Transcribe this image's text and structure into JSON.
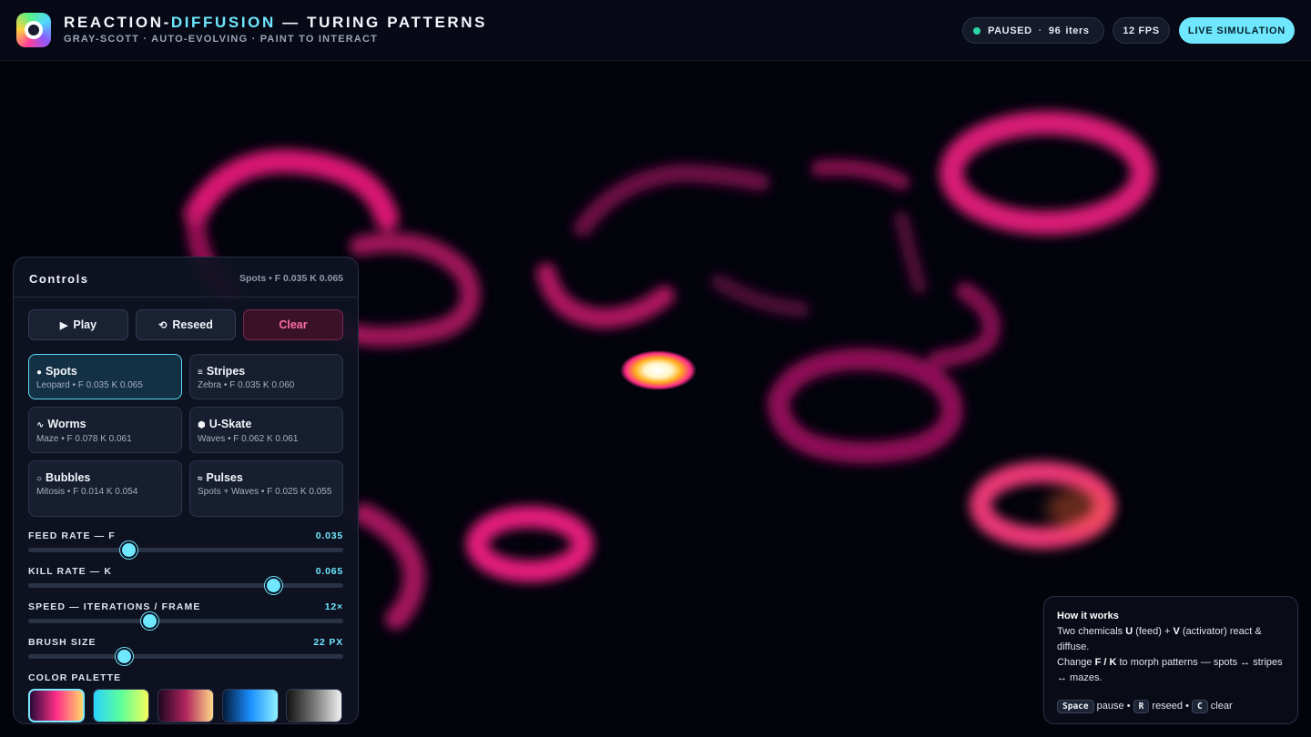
{
  "header": {
    "title_part1": "REACTION-",
    "title_accent": "DIFFUSION",
    "title_part2": " — TURING PATTERNS",
    "subtitle": "GRAY-SCOTT · AUTO-EVOLVING · PAINT TO INTERACT",
    "status": "PAUSED",
    "separator": "·",
    "iterations": "96",
    "iterations_unit": "iters",
    "fps": "12 FPS",
    "live_button": "LIVE SIMULATION",
    "status_dot_color": "#2bd4a4",
    "accent_color": "#6fe6ff"
  },
  "controls": {
    "title": "Controls",
    "current_preset": "Spots • F 0.035 K 0.065",
    "buttons": {
      "play": "Play",
      "play_icon": "▶",
      "reseed": "Reseed",
      "reseed_icon": "⟲",
      "clear": "Clear"
    },
    "presets": [
      {
        "icon": "●",
        "name": "Spots",
        "desc": "Leopard • F 0.035 K 0.065",
        "active": true
      },
      {
        "icon": "≡",
        "name": "Stripes",
        "desc": "Zebra • F 0.035 K 0.060",
        "active": false
      },
      {
        "icon": "∿",
        "name": "Worms",
        "desc": "Maze • F 0.078 K 0.061",
        "active": false
      },
      {
        "icon": "⬢",
        "name": "U-Skate",
        "desc": "Waves • F 0.062 K 0.061",
        "active": false
      },
      {
        "icon": "○",
        "name": "Bubbles",
        "desc": "Mitosis • F 0.014 K 0.054",
        "active": false
      },
      {
        "icon": "≈",
        "name": "Pulses",
        "desc": "Spots + Waves • F 0.025 K 0.055",
        "active": false
      }
    ],
    "sliders": {
      "feed": {
        "label": "FEED RATE — F",
        "value": "0.035",
        "position": 0.32
      },
      "kill": {
        "label": "KILL RATE — K",
        "value": "0.065",
        "position": 0.78
      },
      "speed": {
        "label": "SPEED — ITERATIONS / FRAME",
        "value": "12×",
        "position": 0.385
      },
      "brush": {
        "label": "BRUSH SIZE",
        "value": "22 PX",
        "position": 0.305
      }
    },
    "palette_label": "COLOR PALETTE",
    "palettes": [
      {
        "name": "magma",
        "colors": [
          "#2a0a3a",
          "#ff2e88",
          "#ffd76a"
        ],
        "selected": true
      },
      {
        "name": "aurora",
        "colors": [
          "#2ad3ff",
          "#5cff9a",
          "#f7ff5a"
        ],
        "selected": false
      },
      {
        "name": "ember",
        "colors": [
          "#1d0620",
          "#b0245c",
          "#ffd98a"
        ],
        "selected": false
      },
      {
        "name": "ocean",
        "colors": [
          "#021a3a",
          "#1a8fff",
          "#8ff0ff"
        ],
        "selected": false
      },
      {
        "name": "mono",
        "colors": [
          "#111111",
          "#777777",
          "#f2f2f2"
        ],
        "selected": false
      }
    ]
  },
  "info": {
    "heading": "How it works",
    "line1_a": "Two chemicals ",
    "line1_u": "U",
    "line1_b": " (feed) + ",
    "line1_v": "V",
    "line1_c": " (activator) react & diffuse.",
    "line2_a": "Change ",
    "line2_fk": "F / K",
    "line2_b": " to morph patterns — spots ↔ stripes ↔ mazes.",
    "key_space": "Space",
    "key_space_action": " pause • ",
    "key_r": "R",
    "key_r_action": " reseed • ",
    "key_c": "C",
    "key_c_action": " clear"
  }
}
